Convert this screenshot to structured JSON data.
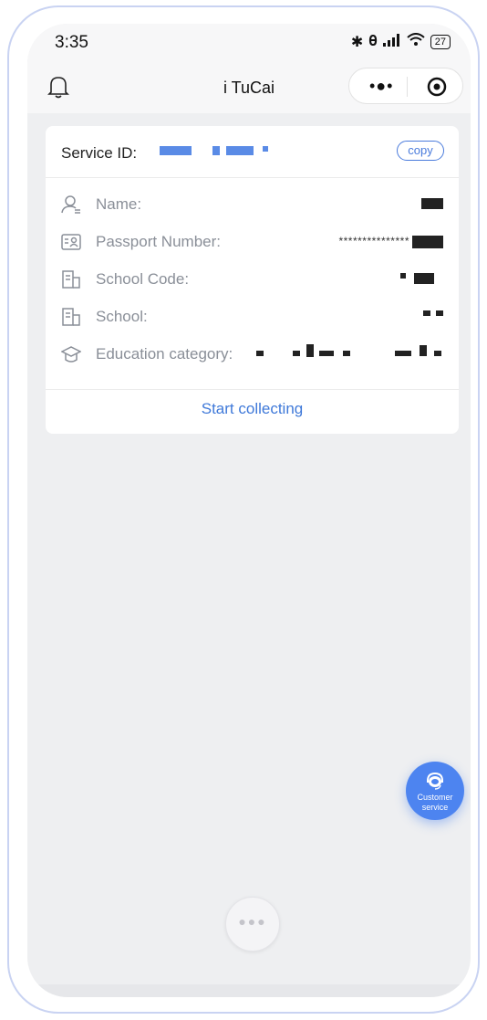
{
  "status_bar": {
    "time": "3:35",
    "battery": "27"
  },
  "nav": {
    "title": "i TuCai"
  },
  "card": {
    "service_id_label": "Service ID:",
    "copy_label": "copy",
    "fields": [
      {
        "label": "Name:",
        "icon": "person-icon"
      },
      {
        "label": "Passport Number:",
        "icon": "id-card-icon",
        "value_prefix": "***************"
      },
      {
        "label": "School Code:",
        "icon": "building-icon"
      },
      {
        "label": "School:",
        "icon": "building-icon"
      },
      {
        "label": "Education category:",
        "icon": "graduation-cap-icon"
      }
    ],
    "action_label": "Start collecting"
  },
  "customer_service": {
    "label_line1": "Customer",
    "label_line2": "service"
  },
  "colors": {
    "accent": "#3f79d9",
    "cs_button": "#4d84f0",
    "background": "#eeeff1"
  }
}
